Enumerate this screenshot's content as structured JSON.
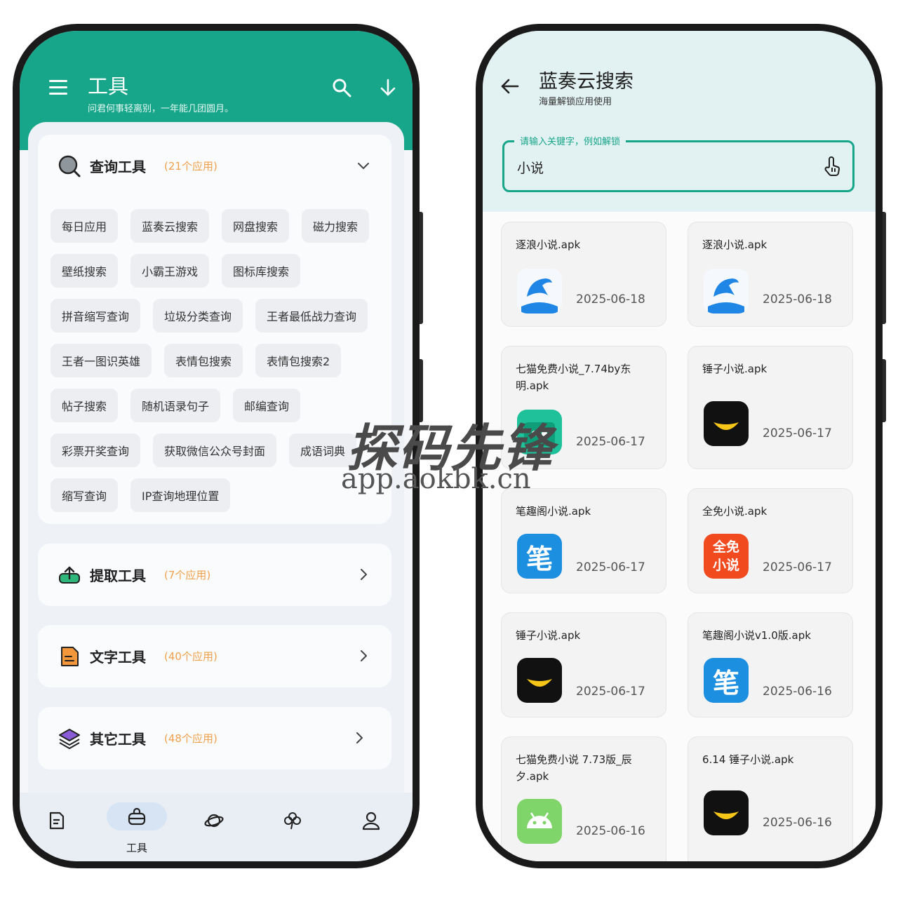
{
  "left": {
    "header": {
      "title": "工具",
      "subtitle": "问君何事轻离别，一年能几团圆月。"
    },
    "sections": [
      {
        "title": "查询工具",
        "count": "(21个应用)",
        "expanded": true
      },
      {
        "title": "提取工具",
        "count": "(7个应用)"
      },
      {
        "title": "文字工具",
        "count": "(40个应用)"
      },
      {
        "title": "其它工具",
        "count": "(48个应用)"
      }
    ],
    "chips": [
      [
        "每日应用",
        "蓝奏云搜索",
        "网盘搜索",
        "磁力搜索"
      ],
      [
        "壁纸搜索",
        "小霸王游戏",
        "图标库搜索"
      ],
      [
        "拼音缩写查询",
        "垃圾分类查询",
        "王者最低战力查询"
      ],
      [
        "王者一图识英雄",
        "表情包搜索",
        "表情包搜索2"
      ],
      [
        "帖子搜索",
        "随机语录句子",
        "邮编查询"
      ],
      [
        "彩票开奖查询",
        "获取微信公众号封面",
        "成语词典"
      ],
      [
        "缩写查询",
        "IP查询地理位置"
      ]
    ],
    "nav": {
      "active_label": "工具"
    }
  },
  "right": {
    "header": {
      "title": "蓝奏云搜索",
      "subtitle": "海量解锁应用使用"
    },
    "search": {
      "legend": "请输入关键字，例如解锁",
      "value": "小说"
    },
    "results": [
      {
        "name": "逐浪小说.apk",
        "date": "2025-06-18",
        "icon": "dolphin-icon"
      },
      {
        "name": "逐浪小说.apk",
        "date": "2025-06-18",
        "icon": "dolphin-icon"
      },
      {
        "name": "七猫免费小说_7.74by东明.apk",
        "date": "2025-06-17",
        "icon": "qimao-icon"
      },
      {
        "name": "锤子小说.apk",
        "date": "2025-06-17",
        "icon": "smile-icon"
      },
      {
        "name": "笔趣阁小说.apk",
        "date": "2025-06-17",
        "icon": "biquge-icon"
      },
      {
        "name": "全免小说.apk",
        "date": "2025-06-17",
        "icon": "quanmian-icon"
      },
      {
        "name": "锤子小说.apk",
        "date": "2025-06-17",
        "icon": "smile-icon"
      },
      {
        "name": "笔趣阁小说v1.0版.apk",
        "date": "2025-06-16",
        "icon": "biquge-icon"
      },
      {
        "name": "七猫免费小说 7.73版_辰夕.apk",
        "date": "2025-06-16",
        "icon": "android-icon"
      },
      {
        "name": "6.14  锤子小说.apk",
        "date": "2025-06-16",
        "icon": "smile-icon"
      }
    ],
    "icon_text": {
      "biquge": "笔",
      "quanmian_top": "全免",
      "quanmian_bottom": "小说"
    }
  },
  "watermark": {
    "line1": "探码先锋",
    "line2": "app.aokbk.cn"
  },
  "colors": {
    "primary": "#17a68a",
    "accent_count": "#f0a04b"
  }
}
